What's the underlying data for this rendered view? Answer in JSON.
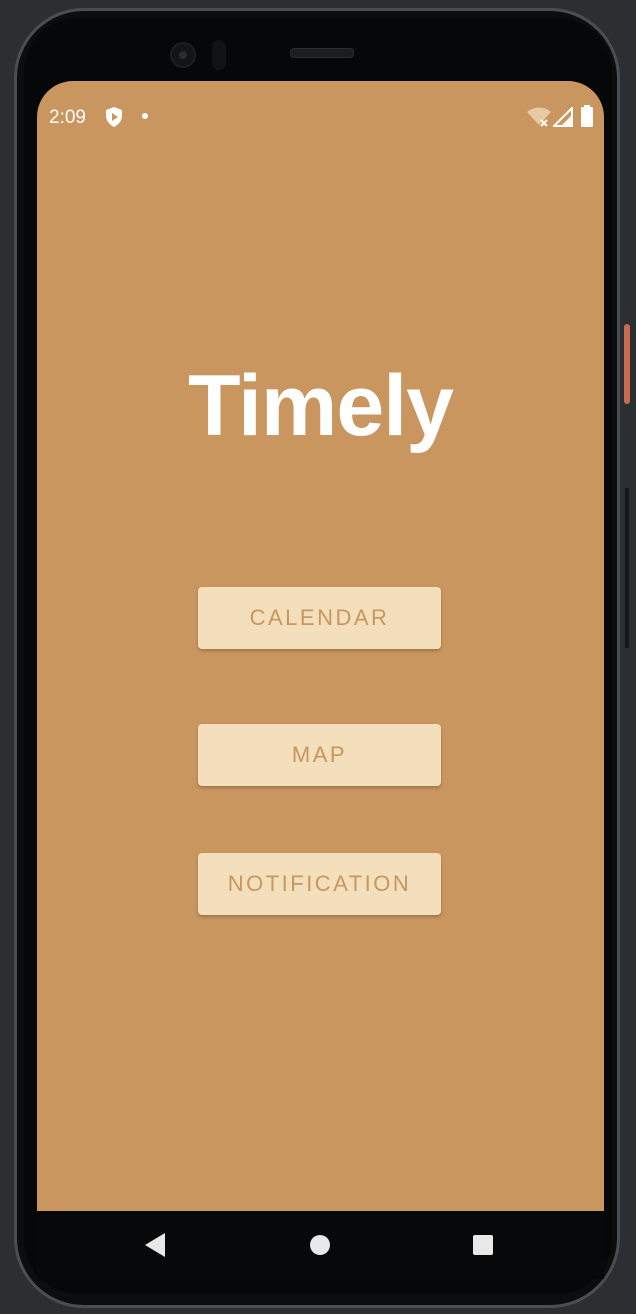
{
  "status_bar": {
    "time": "2:09"
  },
  "app": {
    "title": "Timely",
    "background_color": "#c9965f"
  },
  "buttons": {
    "calendar": "CALENDAR",
    "map": "MAP",
    "notification": "NOTIFICATION"
  },
  "icons": {
    "shield": "shield-play-icon",
    "wifi": "wifi-off-icon",
    "signal": "cell-signal-icon",
    "battery": "battery-icon",
    "back": "back-triangle-icon",
    "home": "home-circle-icon",
    "recent": "recent-apps-square-icon"
  },
  "colors": {
    "button_bg": "#f3dfbc",
    "button_text": "#c9965f",
    "title_text": "#ffffff"
  }
}
